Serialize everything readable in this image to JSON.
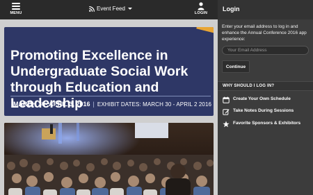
{
  "topbar": {
    "menu_label": "MENU",
    "feed_label": "Event Feed",
    "login_label": "LOGIN"
  },
  "banner": {
    "title": "Promoting Excellence in Undergraduate Social Work through Education and Leadership",
    "dates": "MARCH 30- APRIL 3, 2016",
    "separator": "|",
    "exhibit_dates": "EXHIBIT DATES: MARCH 30 - APRIL 2 2016",
    "accent_color": "#e8a534",
    "background_color": "#2e3766"
  },
  "side": {
    "title": "Login",
    "intro": "Enter your email address to log in and enhance the Annual Conference 2016 app experience:",
    "email_placeholder": "Your Email Address",
    "continue_label": "Continue",
    "why_label": "WHY SHOULD I LOG IN?",
    "benefits": [
      {
        "icon": "calendar-icon",
        "label": "Create Your Own Schedule"
      },
      {
        "icon": "note-edit-icon",
        "label": "Take Notes During Sessions"
      },
      {
        "icon": "star-icon",
        "label": "Favorite Sponsors & Exhibitors"
      }
    ]
  }
}
